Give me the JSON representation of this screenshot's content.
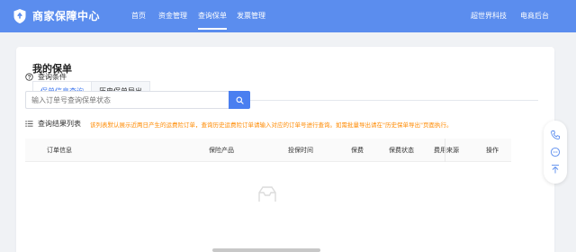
{
  "brand": {
    "title": "商家保障中心",
    "icon": "shield-icon"
  },
  "nav": {
    "items": [
      "首页",
      "资金管理",
      "查询保单",
      "发票管理"
    ],
    "active_index": 2,
    "right_items": [
      "超世界科技",
      "电商后台"
    ]
  },
  "page": {
    "title": "我的保单"
  },
  "tabs": [
    {
      "label": "保单信息查询",
      "active": true
    },
    {
      "label": "历史保单导出",
      "active": false
    }
  ],
  "query": {
    "section_title": "查询条件",
    "search_placeholder": "输入订单号查询保单状态",
    "search_icon": "search-icon"
  },
  "results": {
    "section_title": "查询结果列表",
    "notice": "该列表默认展示近两日产生的运费险订单，查询历史运费险订单请输入对应的订单号进行查询。如需批量导出请在\"历史保单导出\"页面执行。",
    "columns": [
      "订单信息",
      "保险产品",
      "投保时间",
      "保费",
      "保费状态",
      "费用来源",
      "操作"
    ]
  },
  "side_tools": [
    "phone-icon",
    "chat-icon",
    "back-to-top-icon"
  ],
  "colors": {
    "primary": "#5b8dee",
    "accent": "#4a7ff0",
    "warning": "#ff8a00"
  }
}
